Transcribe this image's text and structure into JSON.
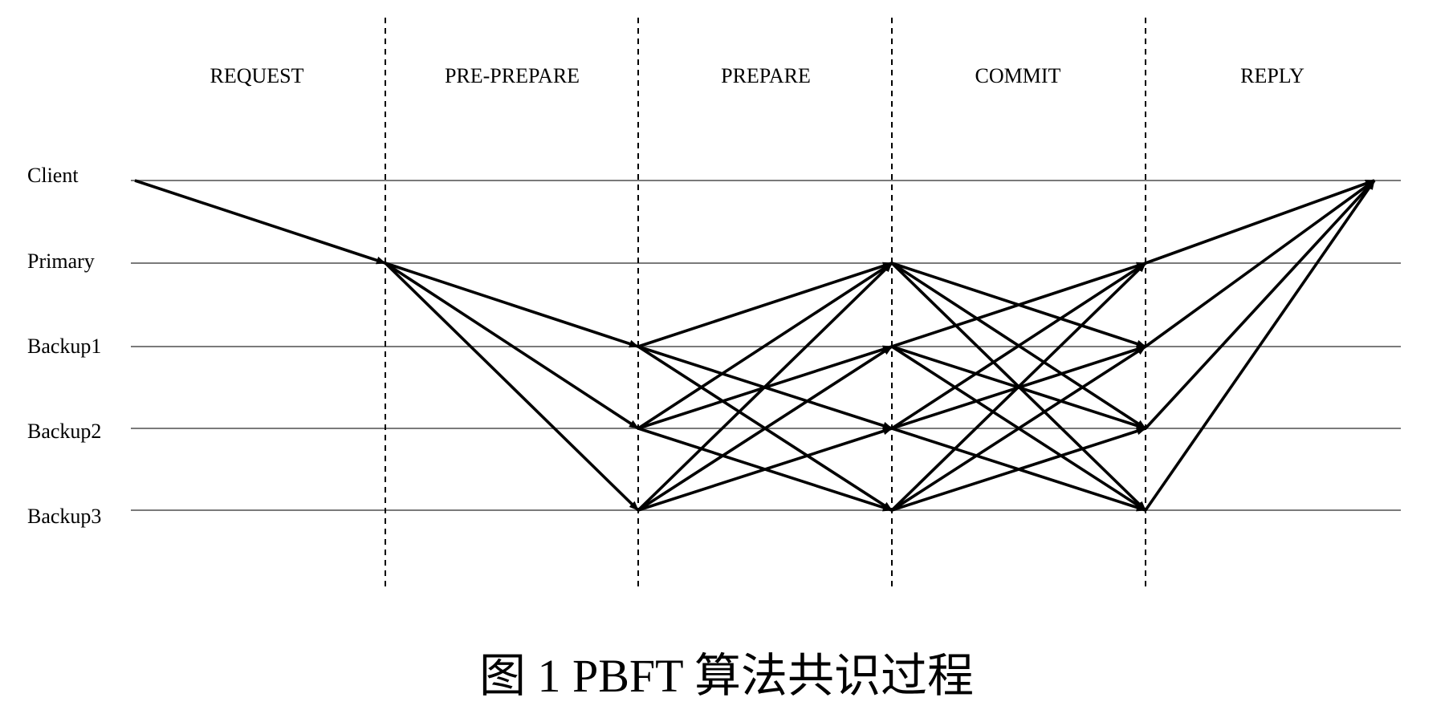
{
  "phases": [
    "REQUEST",
    "PRE-PREPARE",
    "PREPARE",
    "COMMIT",
    "REPLY"
  ],
  "nodes": [
    "Client",
    "Primary",
    "Backup1",
    "Backup2",
    "Backup3"
  ],
  "caption": "图 1 PBFT 算法共识过程",
  "messages": [
    {
      "phase": "REQUEST",
      "from": "Client",
      "to": "Primary"
    },
    {
      "phase": "PRE-PREPARE",
      "from": "Primary",
      "to": "Backup1"
    },
    {
      "phase": "PRE-PREPARE",
      "from": "Primary",
      "to": "Backup2"
    },
    {
      "phase": "PRE-PREPARE",
      "from": "Primary",
      "to": "Backup3"
    },
    {
      "phase": "PREPARE",
      "from": "Backup1",
      "to": "Primary"
    },
    {
      "phase": "PREPARE",
      "from": "Backup1",
      "to": "Backup2"
    },
    {
      "phase": "PREPARE",
      "from": "Backup1",
      "to": "Backup3"
    },
    {
      "phase": "PREPARE",
      "from": "Backup2",
      "to": "Primary"
    },
    {
      "phase": "PREPARE",
      "from": "Backup2",
      "to": "Backup1"
    },
    {
      "phase": "PREPARE",
      "from": "Backup2",
      "to": "Backup3"
    },
    {
      "phase": "PREPARE",
      "from": "Backup3",
      "to": "Primary"
    },
    {
      "phase": "PREPARE",
      "from": "Backup3",
      "to": "Backup1"
    },
    {
      "phase": "PREPARE",
      "from": "Backup3",
      "to": "Backup2"
    },
    {
      "phase": "COMMIT",
      "from": "Primary",
      "to": "Backup1"
    },
    {
      "phase": "COMMIT",
      "from": "Primary",
      "to": "Backup2"
    },
    {
      "phase": "COMMIT",
      "from": "Primary",
      "to": "Backup3"
    },
    {
      "phase": "COMMIT",
      "from": "Backup1",
      "to": "Primary"
    },
    {
      "phase": "COMMIT",
      "from": "Backup1",
      "to": "Backup2"
    },
    {
      "phase": "COMMIT",
      "from": "Backup1",
      "to": "Backup3"
    },
    {
      "phase": "COMMIT",
      "from": "Backup2",
      "to": "Primary"
    },
    {
      "phase": "COMMIT",
      "from": "Backup2",
      "to": "Backup1"
    },
    {
      "phase": "COMMIT",
      "from": "Backup2",
      "to": "Backup3"
    },
    {
      "phase": "COMMIT",
      "from": "Backup3",
      "to": "Primary"
    },
    {
      "phase": "COMMIT",
      "from": "Backup3",
      "to": "Backup1"
    },
    {
      "phase": "COMMIT",
      "from": "Backup3",
      "to": "Backup2"
    },
    {
      "phase": "REPLY",
      "from": "Primary",
      "to": "Client"
    },
    {
      "phase": "REPLY",
      "from": "Backup1",
      "to": "Client"
    },
    {
      "phase": "REPLY",
      "from": "Backup2",
      "to": "Client"
    },
    {
      "phase": "REPLY",
      "from": "Backup3",
      "to": "Client"
    }
  ]
}
